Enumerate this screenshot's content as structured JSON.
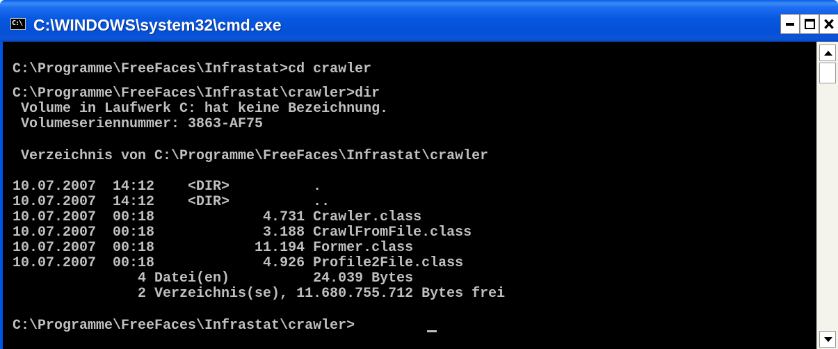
{
  "window": {
    "title": "C:\\WINDOWS\\system32\\cmd.exe",
    "icon": "console-icon",
    "icon_glyph": "C:\\",
    "buttons": {
      "minimize": "minimize-icon",
      "maximize": "maximize-icon",
      "close": "close-icon"
    }
  },
  "console": {
    "lines": [
      "C:\\Programme\\FreeFaces\\Infrastat>cd crawler",
      "C:\\Programme\\FreeFaces\\Infrastat\\crawler>dir",
      " Volume in Laufwerk C: hat keine Bezeichnung.",
      " Volumeseriennummer: 3863-AF75",
      " Verzeichnis von C:\\Programme\\FreeFaces\\Infrastat\\crawler",
      "10.07.2007  14:12    <DIR>          .",
      "10.07.2007  14:12    <DIR>          ..",
      "10.07.2007  00:18             4.731 Crawler.class",
      "10.07.2007  00:18             3.188 CrawlFromFile.class",
      "10.07.2007  00:18            11.194 Former.class",
      "10.07.2007  00:18             4.926 Profile2File.class",
      "               4 Datei(en)          24.039 Bytes",
      "               2 Verzeichnis(se), 11.680.755.712 Bytes frei",
      "C:\\Programme\\FreeFaces\\Infrastat\\crawler>"
    ]
  },
  "colors": {
    "titlebar": "#0055e5",
    "console_background": "#000000",
    "console_text": "#c0c0c0"
  }
}
